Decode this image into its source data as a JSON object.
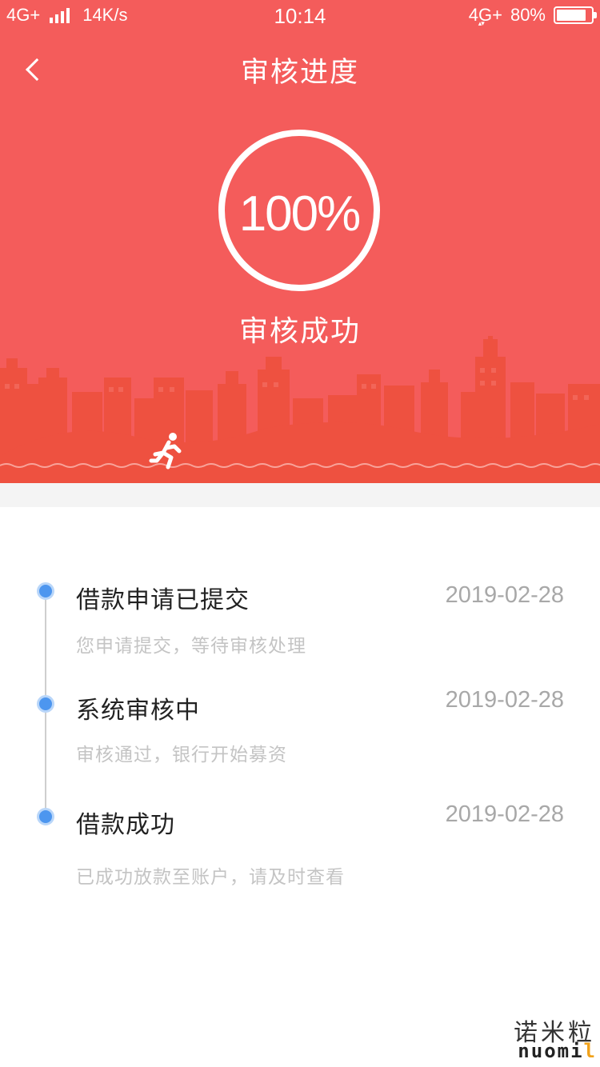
{
  "status_bar": {
    "network_left": "4G+",
    "speed": "14K/s",
    "time": "10:14",
    "network_right": "4G+",
    "battery": "80%"
  },
  "nav": {
    "title": "审核进度",
    "back_icon": "chevron-left-icon"
  },
  "progress": {
    "value": "100%",
    "percent": 100,
    "status": "审核成功"
  },
  "timeline": {
    "items": [
      {
        "title": "借款申请已提交",
        "date": "2019-02-28",
        "description": "您申请提交，等待审核处理"
      },
      {
        "title": "系统审核中",
        "date": "2019-02-28",
        "description": "审核通过，银行开始募资"
      },
      {
        "title": "借款成功",
        "date": "2019-02-28",
        "description": "已成功放款至账户，请及时查看"
      }
    ]
  },
  "watermark": {
    "text_cn": "诺米粒",
    "text_en_main": "nuomi",
    "text_en_end": "l"
  },
  "colors": {
    "header_bg": "#f45c5b",
    "city_fill": "#ee5140",
    "timeline_dot": "#4d96ef",
    "date_text": "#a8a8a8"
  }
}
